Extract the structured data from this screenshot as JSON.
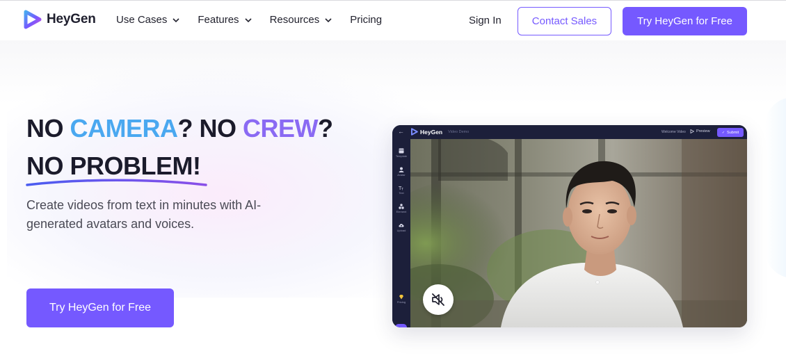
{
  "nav": {
    "logo_text": "HeyGen",
    "menu": [
      {
        "label": "Use Cases",
        "has_dropdown": true
      },
      {
        "label": "Features",
        "has_dropdown": true
      },
      {
        "label": "Resources",
        "has_dropdown": true
      },
      {
        "label": "Pricing",
        "has_dropdown": false
      }
    ],
    "sign_in": "Sign In",
    "contact_sales": "Contact Sales",
    "try_free": "Try HeyGen for Free"
  },
  "hero": {
    "line1": {
      "part1": "NO ",
      "part2": "CAMERA",
      "part3": "? NO ",
      "part4": "CREW",
      "part5": "?"
    },
    "line2": "NO PROBLEM!",
    "subtext": "Create videos from text in minutes with AI-generated avatars and voices.",
    "cta": "Try HeyGen for Free"
  },
  "mockup": {
    "logo_text": "HeyGen",
    "project_label": "Video Demo",
    "title": "Welcome Video",
    "preview": "Preview",
    "submit": "Submit",
    "sidebar": [
      {
        "label": "Template",
        "icon": "template-icon"
      },
      {
        "label": "Avatar",
        "icon": "avatar-icon"
      },
      {
        "label": "Text",
        "icon": "text-icon"
      },
      {
        "label": "Element",
        "icon": "element-icon"
      },
      {
        "label": "Upload",
        "icon": "upload-icon"
      },
      {
        "label": "Pricing",
        "icon": "diamond-icon"
      }
    ],
    "mute_icon": "muted-speaker-icon"
  },
  "colors": {
    "accent": "#7559ff",
    "camera": "#4aa8f0",
    "crew": "#8a6af3",
    "heading": "#1b1b2b",
    "mockup_bg": "#1c1f3a"
  }
}
